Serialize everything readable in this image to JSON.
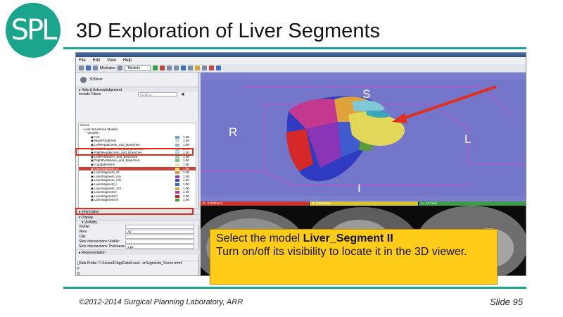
{
  "slide": {
    "logo_text": "SPL",
    "title": "3D Exploration of Liver Segments",
    "footer_copyright": "©2012-2014 Surgical Planning Laboratory, ARR",
    "slide_number": "Slide 95",
    "accent_color": "#1aa58c"
  },
  "app": {
    "menu": [
      "File",
      "Edit",
      "View",
      "Help"
    ],
    "modules_label": "Modules:",
    "module_selected": "Models",
    "panel_logo": "3DSlicer",
    "sections": {
      "help": "Help & Acknowledgement",
      "information": "Information",
      "display": "Display",
      "representation": "Representation",
      "visibility": "Visibility"
    },
    "include_fibers_label": "Include Fibers",
    "scroll_placeholder": "Scroll to...",
    "tree": [
      {
        "label": "Scene",
        "indent": 0
      },
      {
        "label": "Liver Structures Models",
        "indent": 1
      },
      {
        "label": "Vessels",
        "indent": 2
      },
      {
        "label": "IVC",
        "indent": 3,
        "color": "#6fa7d8",
        "opacity": "1.00"
      },
      {
        "label": "MainPortalVein",
        "indent": 3,
        "color": "#d3d3d3",
        "opacity": "1.00"
      },
      {
        "label": "LeftHepaticVein_and_Branches",
        "indent": 3,
        "color": "#7fb7e0",
        "opacity": "1.00"
      },
      {
        "label": "MiddleHepaticVein_and_Branches",
        "indent": 3,
        "color": "#9ac4e8",
        "opacity": "1.00"
      },
      {
        "label": "RightHepaticVein_and_Branches",
        "indent": 3,
        "color": "#a7d2ef",
        "opacity": "1.00"
      },
      {
        "label": "LeftPortalVein_and_Branches",
        "indent": 3,
        "color": "#8cc7a3",
        "opacity": "1.00"
      },
      {
        "label": "RightPortalVein_and_Branches",
        "indent": 3,
        "color": "#70c48a",
        "opacity": "1.00"
      },
      {
        "label": "CaudateVeins",
        "indent": 3,
        "color": "#e6e5a0",
        "opacity": "1.00"
      },
      {
        "label": "LiverSegment_II",
        "indent": 3,
        "color": "#e8d95f",
        "opacity": "1.00",
        "selected": true
      },
      {
        "label": "LiverSegment_III",
        "indent": 3,
        "color": "#d89a3c",
        "opacity": "1.00"
      },
      {
        "label": "LiverSegment_IVa",
        "indent": 3,
        "color": "#8a3db0",
        "opacity": "1.00"
      },
      {
        "label": "LiverSegment_IVb",
        "indent": 3,
        "color": "#4a3cc7",
        "opacity": "1.00"
      },
      {
        "label": "LiverSegment_I",
        "indent": 3,
        "color": "#3566c9",
        "opacity": "1.00"
      },
      {
        "label": "LiverSegment_VIII",
        "indent": 3,
        "color": "#e0a34a",
        "opacity": "1.00"
      },
      {
        "label": "LiverSegmentV",
        "indent": 3,
        "color": "#c43c9c",
        "opacity": "1.00"
      },
      {
        "label": "LiverSegmentVI",
        "indent": 3,
        "color": "#c42424",
        "opacity": "1.00"
      },
      {
        "label": "LiverSegmentVII",
        "indent": 3,
        "color": "#4f9a3a",
        "opacity": "1.00"
      }
    ],
    "display_fields": [
      {
        "label": "Visible:",
        "value": ""
      },
      {
        "label": "View:",
        "value": "All"
      },
      {
        "label": "Clip:",
        "value": ""
      },
      {
        "label": "Slice Intersections Visible:",
        "value": ""
      },
      {
        "label": "Slice Intersections Thickness:",
        "value": "1 px"
      }
    ],
    "data_probe": "Data Probe: C:/Users/F/AppData/Local...erSegments_Scene.mrml",
    "probe_letters": [
      "L",
      "F",
      "B"
    ],
    "viewer_3d": {
      "label_s": "S",
      "label_r": "R",
      "label_l": "L",
      "label_i": "I"
    },
    "slice_bars": [
      {
        "id": "R",
        "color": "#c7372e",
        "value": "S: -0.0000mm"
      },
      {
        "id": "Y",
        "color": "#d8c23a",
        "value": "R: 0.0000mm"
      },
      {
        "id": "G",
        "color": "#3e9b4a",
        "value": "A: -43.7mm"
      }
    ]
  },
  "callout": {
    "prefix": "Select the model ",
    "model_name": "Liver_Segment II",
    "line2": "Turn on/off its visibility to locate it in the 3D viewer."
  }
}
